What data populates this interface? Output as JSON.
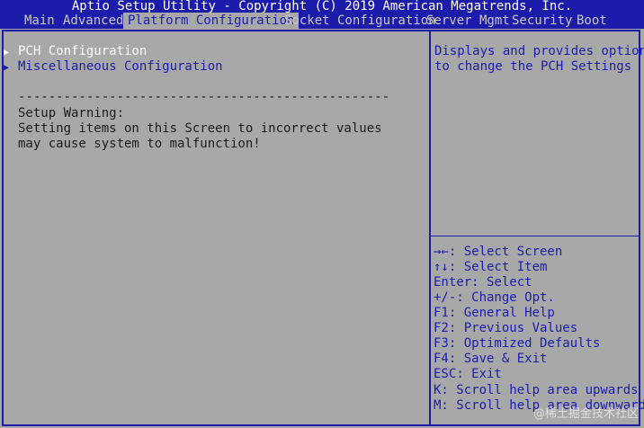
{
  "title": "Aptio Setup Utility - Copyright (C) 2019 American Megatrends, Inc.",
  "tabs": [
    {
      "label": "Main"
    },
    {
      "label": "Advanced"
    },
    {
      "label": "Platform Configuration",
      "active": true
    },
    {
      "label": "Socket Configuration"
    },
    {
      "label": "Server Mgmt"
    },
    {
      "label": "Security"
    },
    {
      "label": "Boot"
    }
  ],
  "main": {
    "items": [
      {
        "label": "PCH Configuration",
        "selected": true
      },
      {
        "label": "Miscellaneous Configuration"
      }
    ],
    "divider": "-------------------------------------------------",
    "warning": [
      "Setup Warning:",
      "Setting items on this Screen to incorrect values",
      "may cause system to malfunction!"
    ]
  },
  "help": {
    "description": [
      "Displays and provides option",
      "to change the PCH Settings"
    ],
    "keys": [
      "→←: Select Screen",
      "↑↓: Select Item",
      "Enter: Select",
      "+/-: Change Opt.",
      "F1: General Help",
      "F2: Previous Values",
      "F3: Optimized Defaults",
      "F4: Save & Exit",
      "ESC: Exit",
      "K: Scroll help area upwards",
      "M: Scroll help area downwards"
    ]
  },
  "watermark": "@稀土掘金技术社区",
  "colors": {
    "background": "#a8a8a8",
    "accent": "#1c1cab",
    "selected": "#ffffff"
  }
}
